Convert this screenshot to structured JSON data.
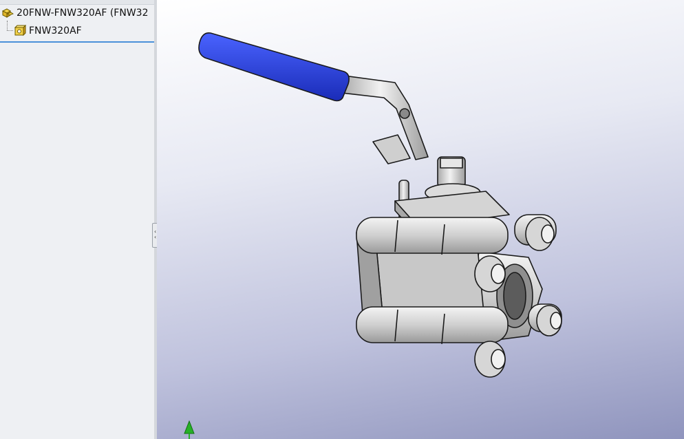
{
  "feature_tree": {
    "assembly": {
      "label": "20FNW-FNW320AF  (FNW32",
      "icon": "assembly-icon"
    },
    "part": {
      "label": "FNW320AF",
      "icon": "part-icon"
    }
  },
  "viewport": {
    "model": "ball-valve-model",
    "colors": {
      "handle_grip": "#2a3fd0",
      "metal": "#d8d8d8",
      "outline": "#1a1a1a",
      "triad_green": "#27b027"
    }
  }
}
